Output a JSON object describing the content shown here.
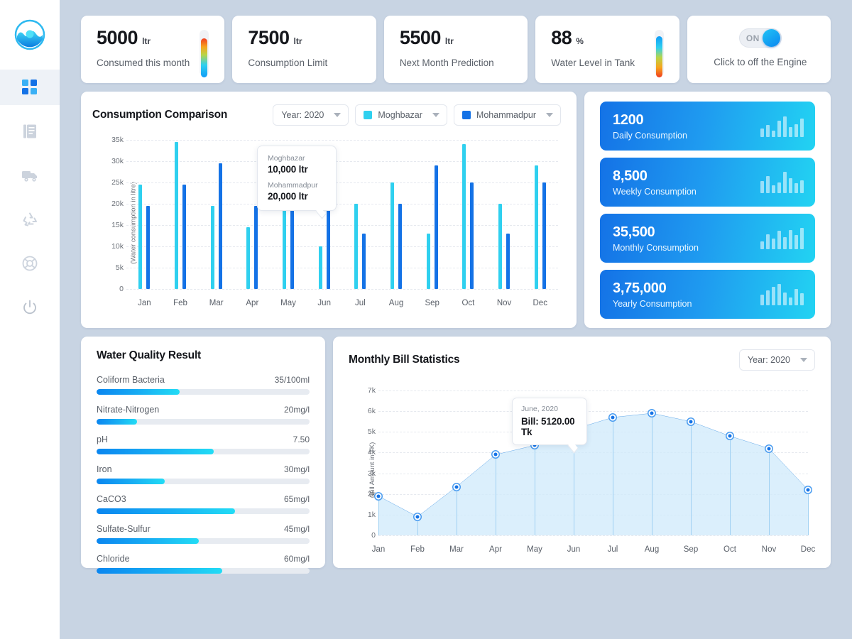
{
  "sidebar": {
    "logo": "water-drop-logo",
    "items": [
      {
        "name": "dashboard",
        "icon": "grid-icon",
        "active": true
      },
      {
        "name": "reports",
        "icon": "document-icon",
        "active": false
      },
      {
        "name": "delivery",
        "icon": "truck-icon",
        "active": false
      },
      {
        "name": "recycle",
        "icon": "recycle-icon",
        "active": false
      },
      {
        "name": "support",
        "icon": "lifebuoy-icon",
        "active": false
      },
      {
        "name": "power",
        "icon": "power-icon",
        "active": false
      }
    ]
  },
  "stats": [
    {
      "value": "5000",
      "unit": "ltr",
      "label": "Consumed this month",
      "indicator": "thermometer-hot-down"
    },
    {
      "value": "7500",
      "unit": "ltr",
      "label": "Consumption Limit",
      "indicator": "none"
    },
    {
      "value": "5500",
      "unit": "ltr",
      "label": "Next Month Prediction",
      "indicator": "none"
    },
    {
      "value": "88",
      "unit": "%",
      "label": "Water Level in Tank",
      "indicator": "thermometer-cold-down"
    }
  ],
  "engine": {
    "toggle_text": "ON",
    "toggle_state": "on",
    "label": "Click to off the Engine"
  },
  "consumption_comparison": {
    "title": "Consumption Comparison",
    "year_dropdown": "Year: 2020",
    "series_dropdowns": [
      {
        "label": "Moghbazar",
        "color": "#2fd0ef"
      },
      {
        "label": "Mohammadpur",
        "color": "#1472e6"
      }
    ],
    "tooltip": {
      "rows": [
        {
          "name": "Moghbazar",
          "value": "10,000 ltr"
        },
        {
          "name": "Mohammadpur",
          "value": "20,000 ltr"
        }
      ]
    }
  },
  "consumption_cards": [
    {
      "value": "1200",
      "label": "Daily Consumption",
      "spark": [
        40,
        55,
        30,
        75,
        95,
        45,
        60,
        85
      ]
    },
    {
      "value": "8,500",
      "label": "Weekly Consumption",
      "spark": [
        55,
        80,
        35,
        50,
        100,
        70,
        45,
        60
      ]
    },
    {
      "value": "35,500",
      "label": "Monthly Consumption",
      "spark": [
        35,
        70,
        50,
        85,
        55,
        90,
        65,
        100
      ]
    },
    {
      "value": "3,75,000",
      "label": "Yearly Consumption",
      "spark": [
        50,
        70,
        85,
        100,
        60,
        35,
        75,
        55
      ]
    }
  ],
  "water_quality": {
    "title": "Water Quality Result",
    "metrics": [
      {
        "name": "Coliform Bacteria",
        "value": "35/100ml",
        "percent": 39
      },
      {
        "name": "Nitrate-Nitrogen",
        "value": "20mg/l",
        "percent": 19
      },
      {
        "name": "pH",
        "value": "7.50",
        "percent": 55
      },
      {
        "name": "Iron",
        "value": "30mg/l",
        "percent": 32
      },
      {
        "name": "CaCO3",
        "value": "65mg/l",
        "percent": 65
      },
      {
        "name": "Sulfate-Sulfur",
        "value": "45mg/l",
        "percent": 48
      },
      {
        "name": "Chloride",
        "value": "60mg/l",
        "percent": 59
      }
    ]
  },
  "monthly_bill": {
    "title": "Monthly Bill Statistics",
    "year_dropdown": "Year: 2020",
    "tooltip": {
      "period": "June, 2020",
      "value": "Bill: 5120.00 Tk"
    }
  },
  "chart_data": [
    {
      "type": "bar",
      "title": "Consumption Comparison",
      "xlabel": "",
      "ylabel": "(Water consumption in litre)",
      "categories": [
        "Jan",
        "Feb",
        "Mar",
        "Apr",
        "May",
        "Jun",
        "Jul",
        "Aug",
        "Sep",
        "Oct",
        "Nov",
        "Dec"
      ],
      "ylim": [
        0,
        35000
      ],
      "yticks": [
        "0",
        "5k",
        "10k",
        "15k",
        "20k",
        "25k",
        "30k",
        "35k"
      ],
      "grid": true,
      "legend_position": "top-right",
      "series": [
        {
          "name": "Moghbazar",
          "color": "#2fd0ef",
          "values": [
            24500,
            34500,
            19500,
            14500,
            20000,
            10000,
            20000,
            25000,
            13000,
            34000,
            20000,
            29000
          ]
        },
        {
          "name": "Mohammadpur",
          "color": "#1472e6",
          "values": [
            19500,
            24500,
            29500,
            19500,
            20500,
            19500,
            13000,
            20000,
            29000,
            25000,
            13000,
            25000
          ]
        }
      ]
    },
    {
      "type": "area",
      "title": "Monthly Bill Statistics",
      "xlabel": "",
      "ylabel": "(Bill Amount in TK)",
      "categories": [
        "Jan",
        "Feb",
        "Mar",
        "Apr",
        "May",
        "Jun",
        "Jul",
        "Aug",
        "Sep",
        "Oct",
        "Nov",
        "Dec"
      ],
      "ylim": [
        0,
        7000
      ],
      "yticks": [
        "0",
        "1k",
        "2k",
        "3k",
        "4k",
        "5k",
        "6k",
        "7k"
      ],
      "grid": true,
      "series": [
        {
          "name": "Bill Amount",
          "color": "#1472e6",
          "values": [
            1900,
            900,
            2350,
            3900,
            4350,
            5120,
            5700,
            5900,
            5500,
            4800,
            4200,
            2200
          ]
        }
      ]
    }
  ]
}
